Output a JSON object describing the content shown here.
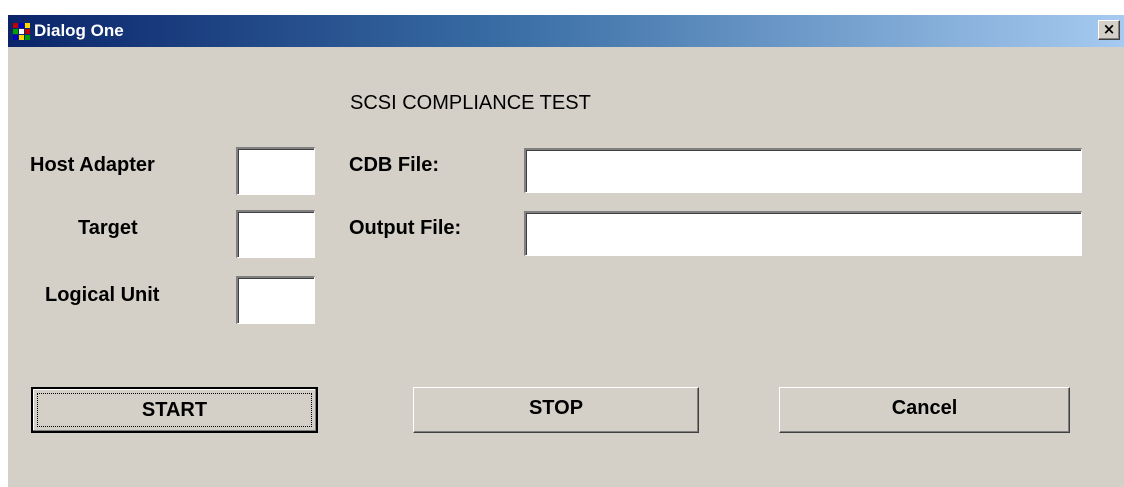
{
  "window": {
    "title": "Dialog One",
    "close_label": "×"
  },
  "heading": "SCSI COMPLIANCE TEST",
  "labels": {
    "host_adapter": "Host Adapter",
    "target": "Target",
    "logical_unit": "Logical Unit",
    "cdb_file": "CDB File:",
    "output_file": "Output File:"
  },
  "fields": {
    "host_adapter": "",
    "target": "",
    "logical_unit": "",
    "cdb_file": "",
    "output_file": ""
  },
  "buttons": {
    "start": "START",
    "stop": "STOP",
    "cancel": "Cancel"
  },
  "colors": {
    "titlebar_start": "#0a246a",
    "titlebar_end": "#a6caf0",
    "face": "#d4d0c8"
  }
}
